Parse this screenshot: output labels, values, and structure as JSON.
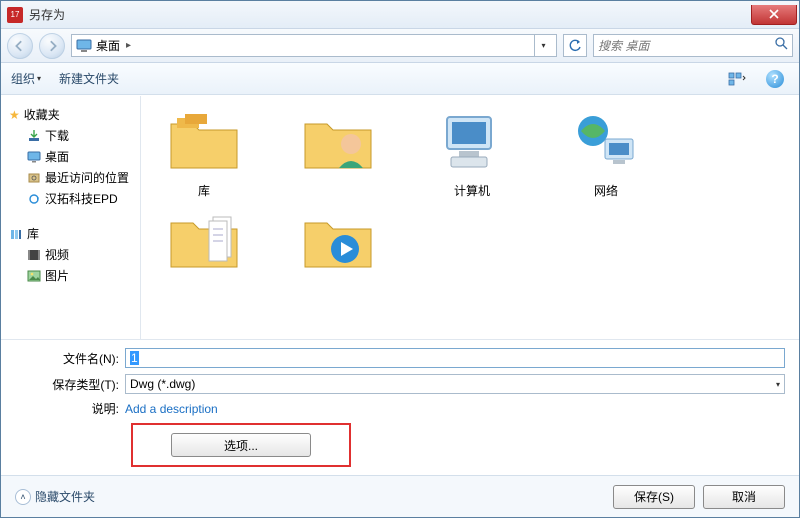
{
  "window": {
    "title": "另存为"
  },
  "nav": {
    "location": "桌面",
    "search_placeholder": "搜索 桌面"
  },
  "toolbar": {
    "organize": "组织",
    "new_folder": "新建文件夹"
  },
  "sidebar": {
    "favorites": {
      "label": "收藏夹"
    },
    "fav_items": [
      {
        "label": "下载"
      },
      {
        "label": "桌面"
      },
      {
        "label": "最近访问的位置"
      },
      {
        "label": "汉拓科技EPD"
      }
    ],
    "libraries": {
      "label": "库"
    },
    "lib_items": [
      {
        "label": "视频"
      },
      {
        "label": "图片"
      }
    ]
  },
  "content_items": [
    {
      "label": "库"
    },
    {
      "label": ""
    },
    {
      "label": "计算机"
    },
    {
      "label": "网络"
    },
    {
      "label": ""
    }
  ],
  "content_row2": [
    {
      "label": ""
    }
  ],
  "form": {
    "filename_label": "文件名(N):",
    "filename_value": "1",
    "savetype_label": "保存类型(T):",
    "savetype_value": "Dwg (*.dwg)",
    "desc_label": "说明:",
    "desc_value": "Add a description",
    "options_button": "选项..."
  },
  "footer": {
    "hide_folders": "隐藏文件夹",
    "save": "保存(S)",
    "cancel": "取消"
  }
}
